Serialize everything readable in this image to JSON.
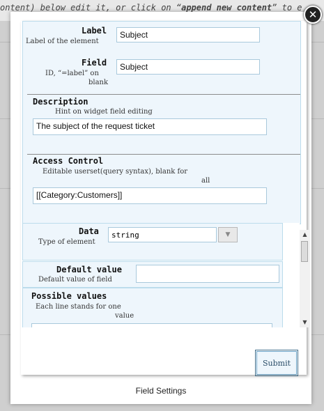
{
  "background": {
    "top_text_prefix": "ontent) below edit it, or click on “",
    "top_text_bold": "append new content",
    "top_text_suffix": "” to e"
  },
  "dialog": {
    "close_label": "✕",
    "footer_title": "Field Settings",
    "submit_label": "Submit"
  },
  "form": {
    "label": {
      "title": "Label",
      "hint": "Label of the element",
      "value": "Subject"
    },
    "field": {
      "title": "Field",
      "hint_line1": "ID, “=label” on",
      "hint_line2": "blank",
      "value": "Subject"
    },
    "description": {
      "title": "Description",
      "hint": "Hint on widget field editing",
      "value": "The subject of the request ticket"
    },
    "access": {
      "title": "Access Control",
      "hint_line1": "Editable userset(query syntax), blank for",
      "hint_line2": "all",
      "value": "[[Category:Customers]]"
    },
    "data": {
      "title": "Data",
      "hint": "Type of element",
      "selected": "string",
      "dropdown_icon": "chevron-down-icon"
    },
    "default_value": {
      "title": "Default value",
      "hint": "Default value of field",
      "value": ""
    },
    "possible_values": {
      "title": "Possible values",
      "hint_line1": "Each line stands for one",
      "hint_line2": "value",
      "value": ""
    }
  },
  "colors": {
    "panel_bg": "#eef6fc",
    "panel_border": "#bcdcec",
    "submit_border": "#6aa2c6"
  }
}
